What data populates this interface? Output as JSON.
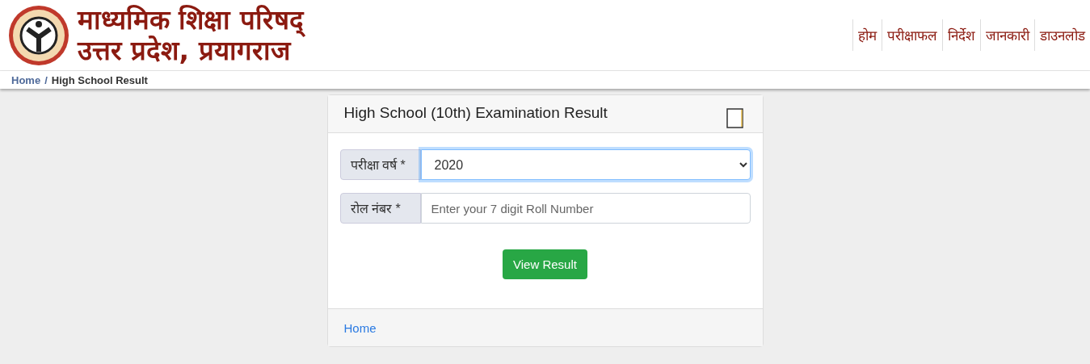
{
  "header": {
    "title_line_1": "माध्यमिक शिक्षा परिषद्",
    "title_line_2": "उत्तर प्रदेश, प्रयागराज",
    "nav": [
      {
        "label": "होम"
      },
      {
        "label": "परीक्षाफल"
      },
      {
        "label": "निर्देश"
      },
      {
        "label": "जानकारी"
      },
      {
        "label": "डाउनलोड"
      }
    ]
  },
  "breadcrumb": [
    {
      "label": "Home",
      "kind": "link"
    },
    {
      "label": "/",
      "kind": "separator"
    },
    {
      "label": "High School Result",
      "kind": "current"
    }
  ],
  "card": {
    "title": "High School (10th) Examination Result",
    "fields": [
      {
        "kind": "select",
        "label": "परीक्षा वर्ष *",
        "value": "2020",
        "focused": true
      },
      {
        "kind": "input",
        "label": "रोल नंबर *",
        "placeholder": "Enter your 7 digit Roll Number",
        "focused": false
      }
    ],
    "button": "View Result",
    "footer_link": "Home"
  }
}
